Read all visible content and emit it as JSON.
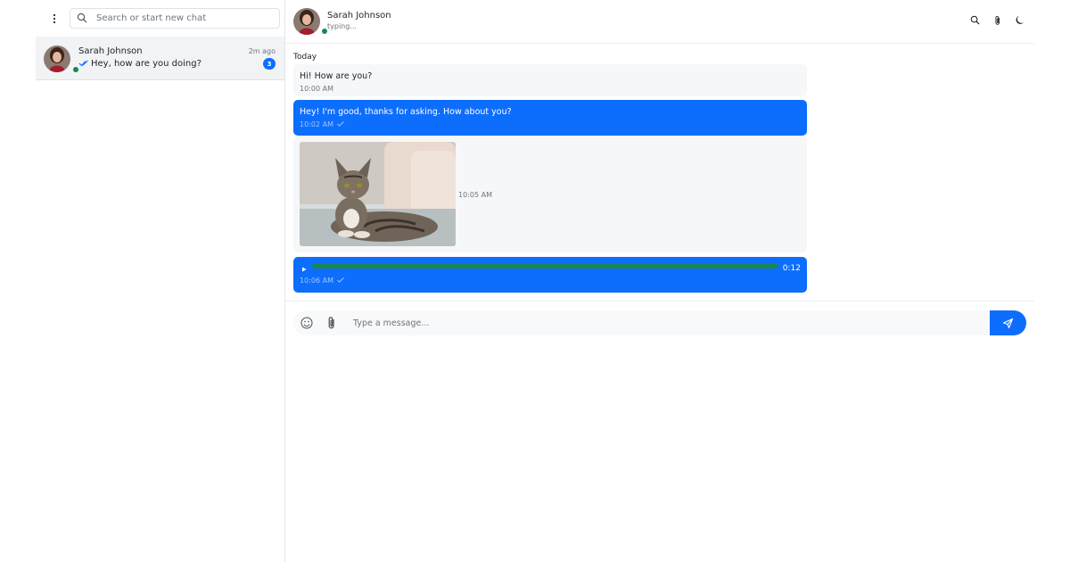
{
  "sidebar": {
    "search": {
      "placeholder": "Search or start new chat"
    },
    "chats": [
      {
        "name": "Sarah Johnson",
        "time": "2m ago",
        "preview": "Hey, how are you doing?",
        "unread": "3",
        "online": true
      }
    ]
  },
  "header": {
    "name": "Sarah Johnson",
    "status": "typing...",
    "actions": [
      "search-icon",
      "paperclip-icon",
      "moon-icon"
    ]
  },
  "conversation": {
    "day_label": "Today",
    "messages": [
      {
        "direction": "incoming",
        "type": "text",
        "text": "Hi! How are you?",
        "time": "10:00 AM"
      },
      {
        "direction": "outgoing",
        "type": "text",
        "text": "Hey! I'm good, thanks for asking. How about you?",
        "time": "10:02 AM"
      },
      {
        "direction": "incoming",
        "type": "image",
        "image": "tabby-cat-photo",
        "time": "10:05 AM"
      },
      {
        "direction": "outgoing",
        "type": "audio",
        "duration": "0:12",
        "progress": 1.0,
        "time": "10:06 AM"
      }
    ]
  },
  "composer": {
    "placeholder": "Type a message..."
  },
  "colors": {
    "accent": "#0d6efd",
    "online": "#198754",
    "audio_track": "#198754",
    "incoming_bubble": "#f6f7f8",
    "selected_chat": "#f1f3f5"
  }
}
